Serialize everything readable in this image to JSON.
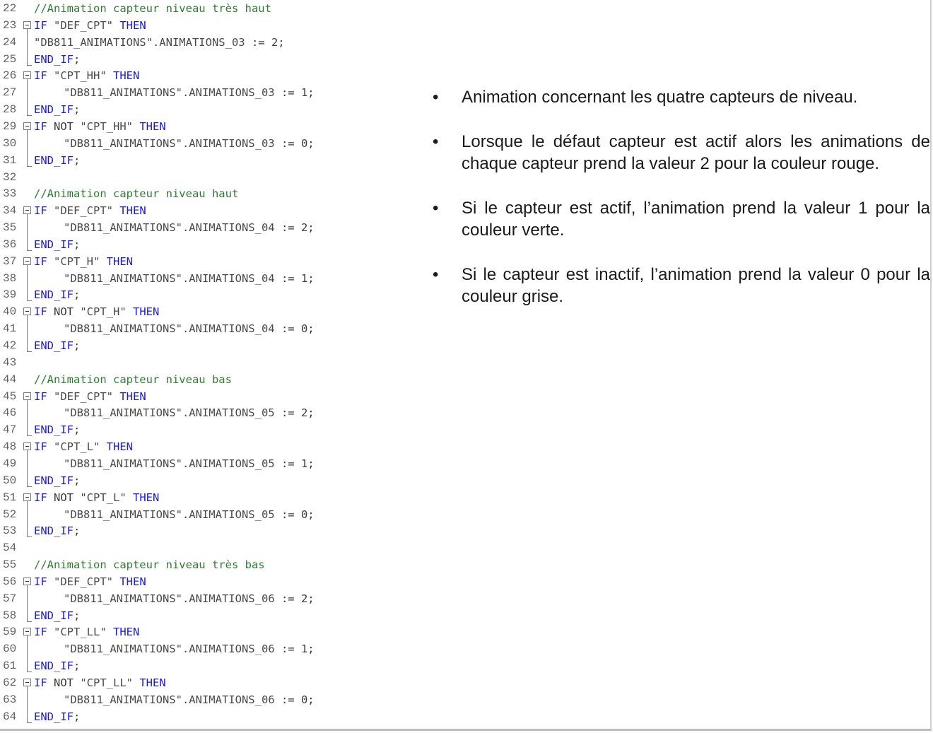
{
  "code": {
    "lines": [
      {
        "n": "22",
        "type": "comment",
        "text": "//Animation capteur niveau très haut"
      },
      {
        "n": "23",
        "type": "if",
        "fold": true,
        "parts": [
          [
            "kw",
            "IF "
          ],
          [
            "str",
            "\"DEF_CPT\" "
          ],
          [
            "kw",
            "THEN"
          ]
        ]
      },
      {
        "n": "24",
        "type": "assign0",
        "parts": [
          [
            "str",
            "\"DB811_ANIMATIONS\".ANIMATIONS_03 "
          ],
          [
            "op",
            ":= "
          ],
          [
            "num",
            "2;"
          ]
        ]
      },
      {
        "n": "25",
        "type": "end",
        "parts": [
          [
            "kw",
            "END_IF"
          ],
          [
            "plain",
            ";"
          ]
        ]
      },
      {
        "n": "26",
        "type": "if",
        "fold": true,
        "parts": [
          [
            "kw",
            "IF "
          ],
          [
            "str",
            "\"CPT_HH\" "
          ],
          [
            "kw",
            "THEN"
          ]
        ]
      },
      {
        "n": "27",
        "type": "assign",
        "parts": [
          [
            "str",
            "\"DB811_ANIMATIONS\".ANIMATIONS_03 "
          ],
          [
            "op",
            ":= "
          ],
          [
            "num",
            "1;"
          ]
        ]
      },
      {
        "n": "28",
        "type": "end",
        "parts": [
          [
            "kw",
            "END_IF"
          ],
          [
            "plain",
            ";"
          ]
        ]
      },
      {
        "n": "29",
        "type": "if",
        "fold": true,
        "parts": [
          [
            "kw",
            "IF "
          ],
          [
            "plain",
            "NOT "
          ],
          [
            "str",
            "\"CPT_HH\" "
          ],
          [
            "kw",
            "THEN"
          ]
        ]
      },
      {
        "n": "30",
        "type": "assign",
        "parts": [
          [
            "str",
            "\"DB811_ANIMATIONS\".ANIMATIONS_03 "
          ],
          [
            "op",
            ":= "
          ],
          [
            "num",
            "0;"
          ]
        ]
      },
      {
        "n": "31",
        "type": "end",
        "parts": [
          [
            "kw",
            "END_IF"
          ],
          [
            "plain",
            ";"
          ]
        ]
      },
      {
        "n": "32",
        "type": "blank"
      },
      {
        "n": "33",
        "type": "comment",
        "text": "//Animation capteur niveau haut"
      },
      {
        "n": "34",
        "type": "if",
        "fold": true,
        "parts": [
          [
            "kw",
            "IF "
          ],
          [
            "str",
            "\"DEF_CPT\" "
          ],
          [
            "kw",
            "THEN"
          ]
        ]
      },
      {
        "n": "35",
        "type": "assign",
        "parts": [
          [
            "str",
            "\"DB811_ANIMATIONS\".ANIMATIONS_04 "
          ],
          [
            "op",
            ":= "
          ],
          [
            "num",
            "2;"
          ]
        ]
      },
      {
        "n": "36",
        "type": "end",
        "parts": [
          [
            "kw",
            "END_IF"
          ],
          [
            "plain",
            ";"
          ]
        ]
      },
      {
        "n": "37",
        "type": "if",
        "fold": true,
        "parts": [
          [
            "kw",
            "IF "
          ],
          [
            "str",
            "\"CPT_H\" "
          ],
          [
            "kw",
            "THEN"
          ]
        ]
      },
      {
        "n": "38",
        "type": "assign",
        "parts": [
          [
            "str",
            "\"DB811_ANIMATIONS\".ANIMATIONS_04 "
          ],
          [
            "op",
            ":= "
          ],
          [
            "num",
            "1;"
          ]
        ]
      },
      {
        "n": "39",
        "type": "end",
        "parts": [
          [
            "kw",
            "END_IF"
          ],
          [
            "plain",
            ";"
          ]
        ]
      },
      {
        "n": "40",
        "type": "if",
        "fold": true,
        "parts": [
          [
            "kw",
            "IF "
          ],
          [
            "plain",
            "NOT "
          ],
          [
            "str",
            "\"CPT_H\" "
          ],
          [
            "kw",
            "THEN"
          ]
        ]
      },
      {
        "n": "41",
        "type": "assign",
        "parts": [
          [
            "str",
            "\"DB811_ANIMATIONS\".ANIMATIONS_04 "
          ],
          [
            "op",
            ":= "
          ],
          [
            "num",
            "0;"
          ]
        ]
      },
      {
        "n": "42",
        "type": "end",
        "parts": [
          [
            "kw",
            "END_IF"
          ],
          [
            "plain",
            ";"
          ]
        ]
      },
      {
        "n": "43",
        "type": "blank"
      },
      {
        "n": "44",
        "type": "comment",
        "text": "//Animation capteur niveau bas"
      },
      {
        "n": "45",
        "type": "if",
        "fold": true,
        "parts": [
          [
            "kw",
            "IF "
          ],
          [
            "str",
            "\"DEF_CPT\" "
          ],
          [
            "kw",
            "THEN"
          ]
        ]
      },
      {
        "n": "46",
        "type": "assign",
        "parts": [
          [
            "str",
            "\"DB811_ANIMATIONS\".ANIMATIONS_05 "
          ],
          [
            "op",
            ":= "
          ],
          [
            "num",
            "2;"
          ]
        ]
      },
      {
        "n": "47",
        "type": "end",
        "parts": [
          [
            "kw",
            "END_IF"
          ],
          [
            "plain",
            ";"
          ]
        ]
      },
      {
        "n": "48",
        "type": "if",
        "fold": true,
        "parts": [
          [
            "kw",
            "IF "
          ],
          [
            "str",
            "\"CPT_L\" "
          ],
          [
            "kw",
            "THEN"
          ]
        ]
      },
      {
        "n": "49",
        "type": "assign",
        "parts": [
          [
            "str",
            "\"DB811_ANIMATIONS\".ANIMATIONS_05 "
          ],
          [
            "op",
            ":= "
          ],
          [
            "num",
            "1;"
          ]
        ]
      },
      {
        "n": "50",
        "type": "end",
        "parts": [
          [
            "kw",
            "END_IF"
          ],
          [
            "plain",
            ";"
          ]
        ]
      },
      {
        "n": "51",
        "type": "if",
        "fold": true,
        "parts": [
          [
            "kw",
            "IF "
          ],
          [
            "plain",
            "NOT "
          ],
          [
            "str",
            "\"CPT_L\" "
          ],
          [
            "kw",
            "THEN"
          ]
        ]
      },
      {
        "n": "52",
        "type": "assign",
        "parts": [
          [
            "str",
            "\"DB811_ANIMATIONS\".ANIMATIONS_05 "
          ],
          [
            "op",
            ":= "
          ],
          [
            "num",
            "0;"
          ]
        ]
      },
      {
        "n": "53",
        "type": "end",
        "parts": [
          [
            "kw",
            "END_IF"
          ],
          [
            "plain",
            ";"
          ]
        ]
      },
      {
        "n": "54",
        "type": "blank"
      },
      {
        "n": "55",
        "type": "comment",
        "text": "//Animation capteur niveau très bas"
      },
      {
        "n": "56",
        "type": "if",
        "fold": true,
        "parts": [
          [
            "kw",
            "IF "
          ],
          [
            "str",
            "\"DEF_CPT\" "
          ],
          [
            "kw",
            "THEN"
          ]
        ]
      },
      {
        "n": "57",
        "type": "assign",
        "parts": [
          [
            "str",
            "\"DB811_ANIMATIONS\".ANIMATIONS_06 "
          ],
          [
            "op",
            ":= "
          ],
          [
            "num",
            "2;"
          ]
        ]
      },
      {
        "n": "58",
        "type": "end",
        "parts": [
          [
            "kw",
            "END_IF"
          ],
          [
            "plain",
            ";"
          ]
        ]
      },
      {
        "n": "59",
        "type": "if",
        "fold": true,
        "parts": [
          [
            "kw",
            "IF "
          ],
          [
            "str",
            "\"CPT_LL\" "
          ],
          [
            "kw",
            "THEN"
          ]
        ]
      },
      {
        "n": "60",
        "type": "assign",
        "parts": [
          [
            "str",
            "\"DB811_ANIMATIONS\".ANIMATIONS_06 "
          ],
          [
            "op",
            ":= "
          ],
          [
            "num",
            "1;"
          ]
        ]
      },
      {
        "n": "61",
        "type": "end",
        "parts": [
          [
            "kw",
            "END_IF"
          ],
          [
            "plain",
            ";"
          ]
        ]
      },
      {
        "n": "62",
        "type": "if",
        "fold": true,
        "parts": [
          [
            "kw",
            "IF "
          ],
          [
            "plain",
            "NOT "
          ],
          [
            "str",
            "\"CPT_LL\" "
          ],
          [
            "kw",
            "THEN"
          ]
        ]
      },
      {
        "n": "63",
        "type": "assign",
        "parts": [
          [
            "str",
            "\"DB811_ANIMATIONS\".ANIMATIONS_06 "
          ],
          [
            "op",
            ":= "
          ],
          [
            "num",
            "0;"
          ]
        ]
      },
      {
        "n": "64",
        "type": "end",
        "parts": [
          [
            "kw",
            "END_IF"
          ],
          [
            "plain",
            ";"
          ]
        ]
      }
    ]
  },
  "notes": {
    "bullet_char": "•",
    "items": [
      "Animation concernant les quatre capteurs de niveau.",
      "Lorsque le défaut capteur est actif alors les animations de chaque capteur prend la valeur 2 pour la couleur rouge.",
      "Si le capteur est actif, l’animation prend la valeur 1 pour la couleur verte.",
      "Si le capteur est inactif, l’animation prend la valeur 0 pour la couleur grise."
    ]
  },
  "colors": {
    "keyword": "#1a1ad6",
    "comment": "#2e7d32",
    "line_number": "#606060",
    "text": "#3a3a3a"
  }
}
